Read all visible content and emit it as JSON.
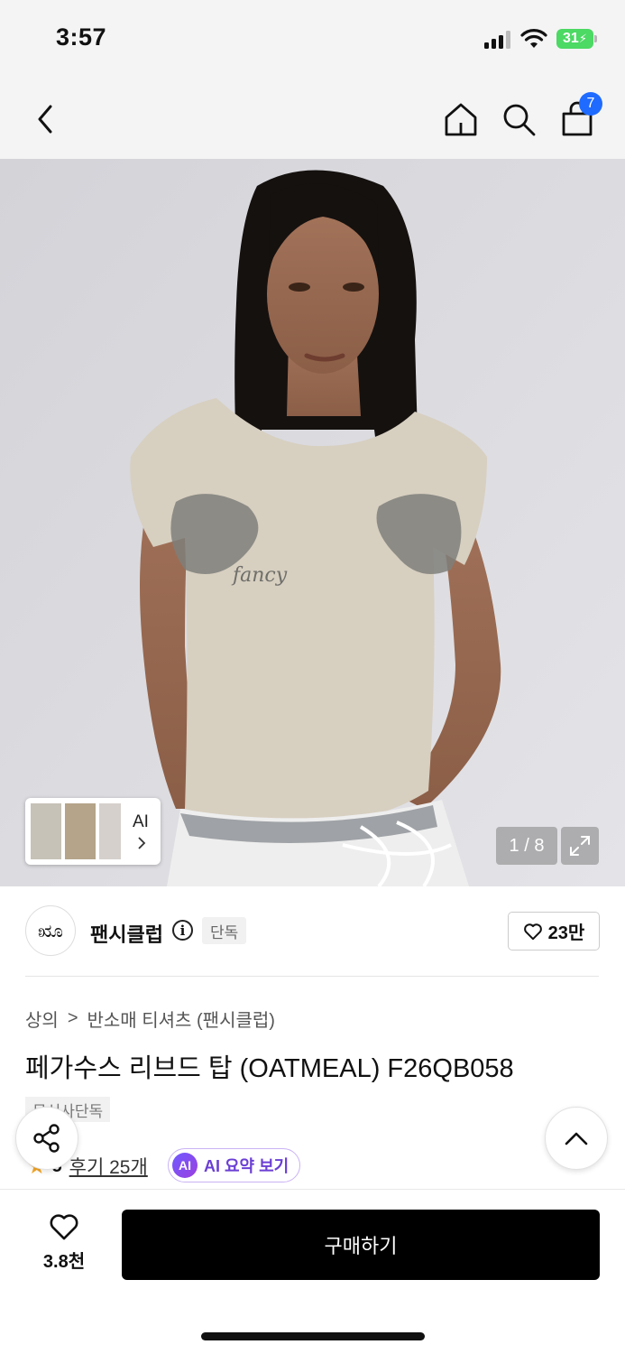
{
  "status": {
    "time": "3:57",
    "battery": "31"
  },
  "nav": {
    "cart_count": "7"
  },
  "hero": {
    "thumbs_label": "AI",
    "counter": "1 / 8"
  },
  "brand": {
    "logo": "ೠ",
    "name": "팬시클럽",
    "exclusive": "단독",
    "likes": "23만"
  },
  "breadcrumb": {
    "category": "상의",
    "separator": ">",
    "subcategory": "반소매 티셔츠 (팬시클럽)"
  },
  "product": {
    "title": "페가수스 리브드 탑 (OATMEAL) F26QB058",
    "tag": "무신사단독"
  },
  "reviews": {
    "rating": "5",
    "review_link": "후기 25개",
    "ai_badge": "AI",
    "ai_summary": "AI 요약 보기"
  },
  "bottom": {
    "wish_count": "3.8천",
    "buy_label": "구매하기"
  },
  "colors": {
    "accent_blue": "#1f6bff",
    "ai_purple": "#6b3fd4",
    "star": "#f5a623",
    "battery": "#4cd964"
  }
}
